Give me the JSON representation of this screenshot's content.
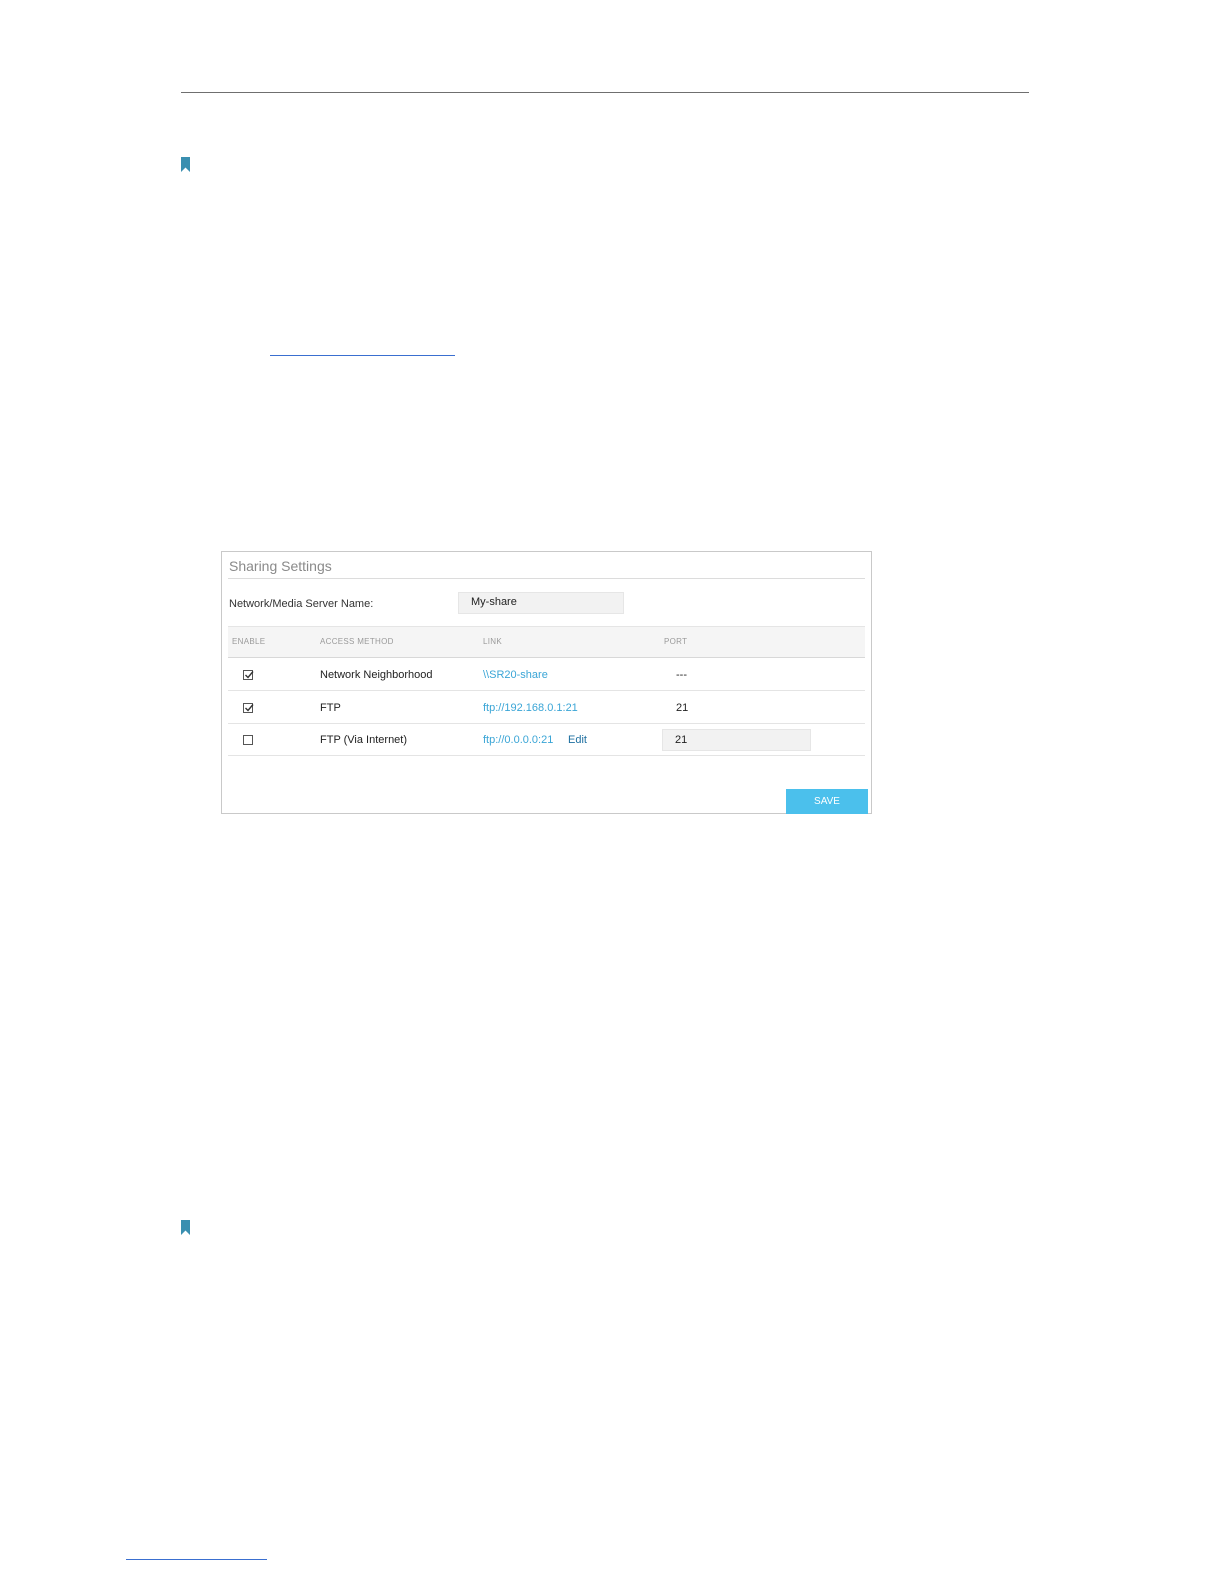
{
  "panel": {
    "title": "Sharing Settings",
    "server_name_label": "Network/Media Server Name:",
    "server_name_value": "My-share",
    "columns": [
      "ENABLE",
      "ACCESS METHOD",
      "LINK",
      "PORT"
    ],
    "rows": [
      {
        "enabled": true,
        "method": "Network Neighborhood",
        "link": "\\\\SR20-share",
        "edit": "",
        "port": "---",
        "port_editable": false
      },
      {
        "enabled": true,
        "method": "FTP",
        "link": "ftp://192.168.0.1:21",
        "edit": "",
        "port": "21",
        "port_editable": false
      },
      {
        "enabled": false,
        "method": "FTP (Via Internet)",
        "link": "ftp://0.0.0.0:21",
        "edit": "Edit",
        "port": "21",
        "port_editable": true
      }
    ],
    "save_label": "SAVE"
  },
  "colors": {
    "accent": "#4bc0ec",
    "link": "#3aa5d6",
    "bookmark": "#3a8fb0"
  },
  "icons": [
    "bookmark-icon",
    "checkbox-checked-icon",
    "checkbox-empty-icon"
  ]
}
